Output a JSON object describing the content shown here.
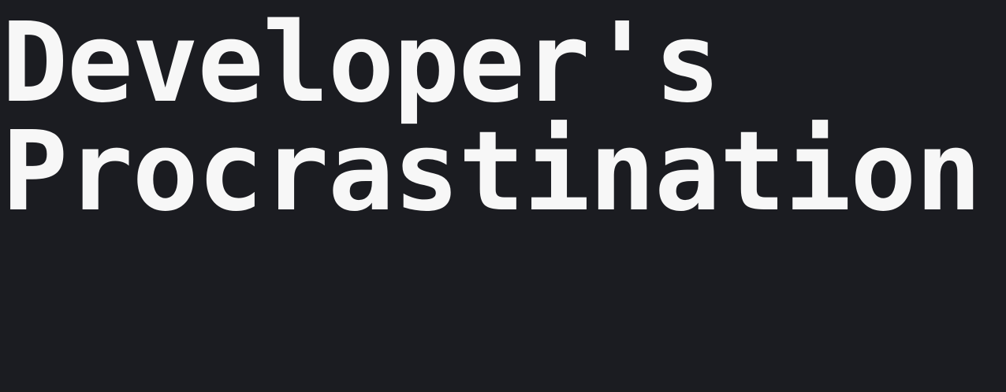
{
  "colors": {
    "background": "#1b1c21",
    "text": "#f7f7f7"
  },
  "hero": {
    "title_line_1": "Developer's",
    "title_line_2": "Procrastination"
  }
}
